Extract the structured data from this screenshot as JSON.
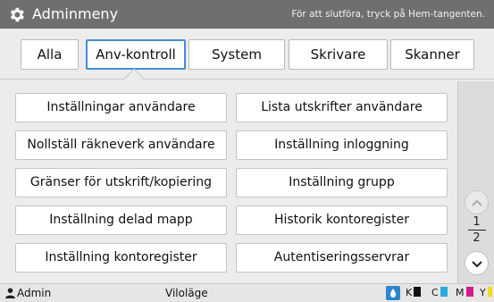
{
  "header": {
    "title": "Adminmeny",
    "hint": "För att slutföra, tryck på Hem-tangenten."
  },
  "tabs": [
    {
      "label": "Alla"
    },
    {
      "label": "Anv-kontroll"
    },
    {
      "label": "System"
    },
    {
      "label": "Skrivare"
    },
    {
      "label": "Skanner"
    }
  ],
  "active_tab": "Anv-kontroll",
  "menu": {
    "items": [
      {
        "label": "Inställningar användare"
      },
      {
        "label": "Lista utskrifter användare"
      },
      {
        "label": "Nollställ räkneverk användare"
      },
      {
        "label": "Inställning inloggning"
      },
      {
        "label": "Gränser för utskrift/kopiering"
      },
      {
        "label": "Inställning grupp"
      },
      {
        "label": "Inställning delad mapp"
      },
      {
        "label": "Historik kontoregister"
      },
      {
        "label": "Inställning kontoregister"
      },
      {
        "label": "Autentiseringsservrar"
      }
    ]
  },
  "pager": {
    "current": "1",
    "total": "2",
    "up_icon": "chevron-up-icon",
    "down_icon": "chevron-down-icon"
  },
  "status": {
    "user": "Admin",
    "state": "Viloläge",
    "inks": [
      {
        "label": "K",
        "color": "#111111"
      },
      {
        "label": "C",
        "color": "#29a9e0"
      },
      {
        "label": "M",
        "color": "#d6198c"
      },
      {
        "label": "Y",
        "color": "#f3dc12"
      }
    ]
  },
  "colors": {
    "active_tab_border": "#3f8ed8",
    "header_bg": "#6f6f6f"
  }
}
